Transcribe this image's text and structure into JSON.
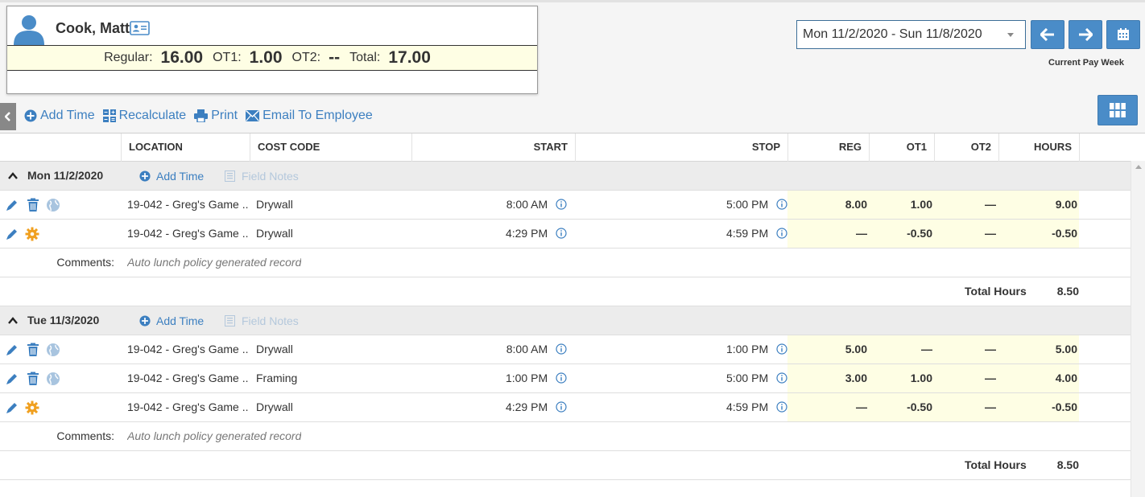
{
  "employee": {
    "name": "Cook, Matt",
    "totals": {
      "regular_label": "Regular:",
      "regular": "16.00",
      "ot1_label": "OT1:",
      "ot1": "1.00",
      "ot2_label": "OT2:",
      "ot2": "--",
      "total_label": "Total:",
      "total": "17.00"
    }
  },
  "date_range": {
    "selected": "Mon 11/2/2020 - Sun 11/8/2020",
    "current_pay_week_label": "Current Pay Week"
  },
  "toolbar": {
    "add_time": "Add Time",
    "recalculate": "Recalculate",
    "print": "Print",
    "email": "Email To Employee"
  },
  "columns": {
    "location": "LOCATION",
    "cost_code": "COST CODE",
    "start": "START",
    "stop": "STOP",
    "reg": "REG",
    "ot1": "OT1",
    "ot2": "OT2",
    "hours": "HOURS"
  },
  "days": [
    {
      "title": "Mon 11/2/2020",
      "add_time": "Add Time",
      "field_notes": "Field Notes",
      "entries": [
        {
          "location": "19-042 - Greg's Game ...",
          "cost_code": "Drywall",
          "start": "8:00 AM",
          "stop": "5:00 PM",
          "reg": "8.00",
          "ot1": "1.00",
          "ot2": "—",
          "hours": "9.00"
        },
        {
          "location": "19-042 - Greg's Game ...",
          "cost_code": "Drywall",
          "start": "4:29 PM",
          "stop": "4:59 PM",
          "reg": "—",
          "ot1": "-0.50",
          "ot2": "—",
          "hours": "-0.50"
        }
      ],
      "comments_label": "Comments:",
      "comment": "Auto lunch policy generated record",
      "total_label": "Total Hours",
      "total": "8.50"
    },
    {
      "title": "Tue 11/3/2020",
      "add_time": "Add Time",
      "field_notes": "Field Notes",
      "entries": [
        {
          "location": "19-042 - Greg's Game ...",
          "cost_code": "Drywall",
          "start": "8:00 AM",
          "stop": "1:00 PM",
          "reg": "5.00",
          "ot1": "—",
          "ot2": "—",
          "hours": "5.00"
        },
        {
          "location": "19-042 - Greg's Game ...",
          "cost_code": "Framing",
          "start": "1:00 PM",
          "stop": "5:00 PM",
          "reg": "3.00",
          "ot1": "1.00",
          "ot2": "—",
          "hours": "4.00"
        },
        {
          "location": "19-042 - Greg's Game ...",
          "cost_code": "Drywall",
          "start": "4:29 PM",
          "stop": "4:59 PM",
          "reg": "—",
          "ot1": "-0.50",
          "ot2": "—",
          "hours": "-0.50"
        }
      ],
      "comments_label": "Comments:",
      "comment": "Auto lunch policy generated record",
      "total_label": "Total Hours",
      "total": "8.50"
    }
  ],
  "colors": {
    "accent": "#4a8cc8",
    "link": "#3c7fc0",
    "highlight": "#fefee4",
    "gear": "#f0a020"
  }
}
